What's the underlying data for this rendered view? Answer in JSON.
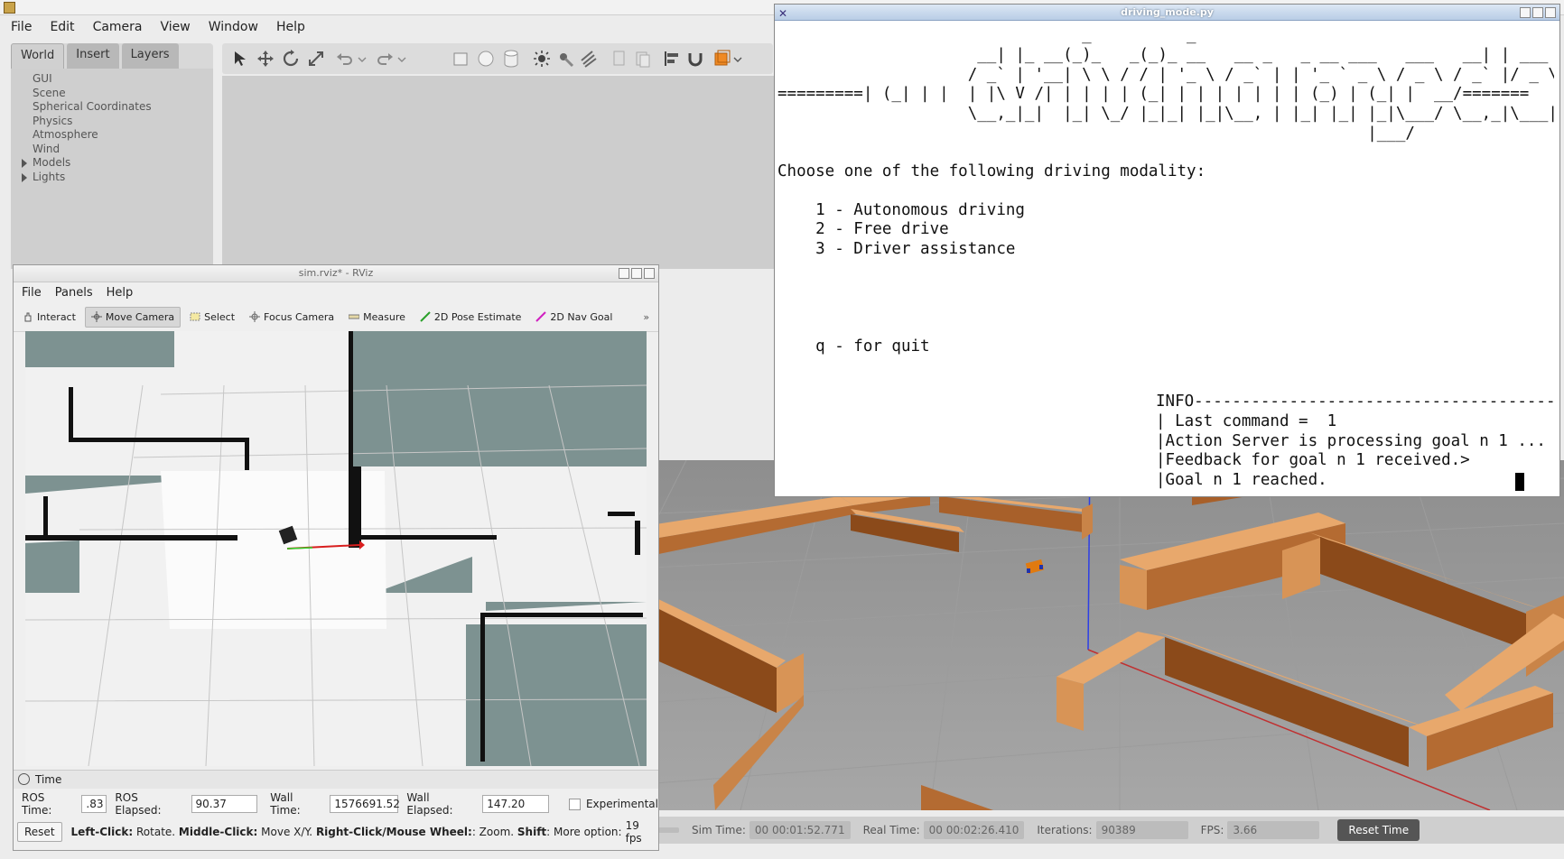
{
  "gazebo": {
    "menu": [
      "File",
      "Edit",
      "Camera",
      "View",
      "Window",
      "Help"
    ],
    "tabs": [
      "World",
      "Insert",
      "Layers"
    ],
    "tree": [
      "GUI",
      "Scene",
      "Spherical Coordinates",
      "Physics",
      "Atmosphere",
      "Wind",
      "Models",
      "Lights"
    ],
    "status": {
      "sim_label": "Sim Time:",
      "sim_value": "00 00:01:52.771",
      "real_label": "Real Time:",
      "real_value": "00 00:02:26.410",
      "iter_label": "Iterations:",
      "iter_value": "90389",
      "fps_label": "FPS:",
      "fps_value": "3.66",
      "reset_time": "Reset Time"
    }
  },
  "rviz": {
    "title": "sim.rviz* - RViz",
    "menu": [
      "File",
      "Panels",
      "Help"
    ],
    "tools": [
      "Interact",
      "Move Camera",
      "Select",
      "Focus Camera",
      "Measure",
      "2D Pose Estimate",
      "2D Nav Goal"
    ],
    "time_header": "Time",
    "ros_time_label": "ROS Time:",
    "ros_time": ".83",
    "ros_elapsed_label": "ROS Elapsed:",
    "ros_elapsed": "90.37",
    "wall_time_label": "Wall Time:",
    "wall_time": "1576691.52",
    "wall_elapsed_label": "Wall Elapsed:",
    "wall_elapsed": "147.20",
    "experimental": "Experimental",
    "reset": "Reset",
    "hint": {
      "a": "Left-Click:",
      "a2": " Rotate. ",
      "b": "Middle-Click:",
      "b2": " Move X/Y. ",
      "c": "Right-Click/Mouse Wheel:",
      "c2": ": Zoom. ",
      "d": "Shift",
      "d2": ": More option:",
      "fps": "19 fps"
    }
  },
  "terminal": {
    "title": "driving_mode.py",
    "banner": "                                _          _                                         _\n                     __| |_ __(_)_   _(_)_ __   __ _   _ __ ___   ___   __| | ___\n                    / _` | '__| \\ \\ / / | '_ \\ / _` | | '_ ` _ \\ / _ \\ / _` |/ _ \\\n=========| (_| | |  | |\\ V /| | | | | (_| | | | | | | | (_) | (_| |  __/=======\n                    \\__,_|_|  |_| \\_/ |_|_| |_|\\__, | |_| |_| |_|\\___/ \\__,_|\\___|\n                                                              |___/",
    "prompt": "Choose one of the following driving modality:",
    "option1": "    1 - Autonomous driving",
    "option2": "    2 - Free drive",
    "option3": "    3 - Driver assistance",
    "quit": "    q - for quit",
    "info": "INFO---------------------------------------------\n| Last command =  1\n|Action Server is processing goal n 1 ...\n|Feedback for goal n 1 received.>\n|Goal n 1 reached."
  }
}
